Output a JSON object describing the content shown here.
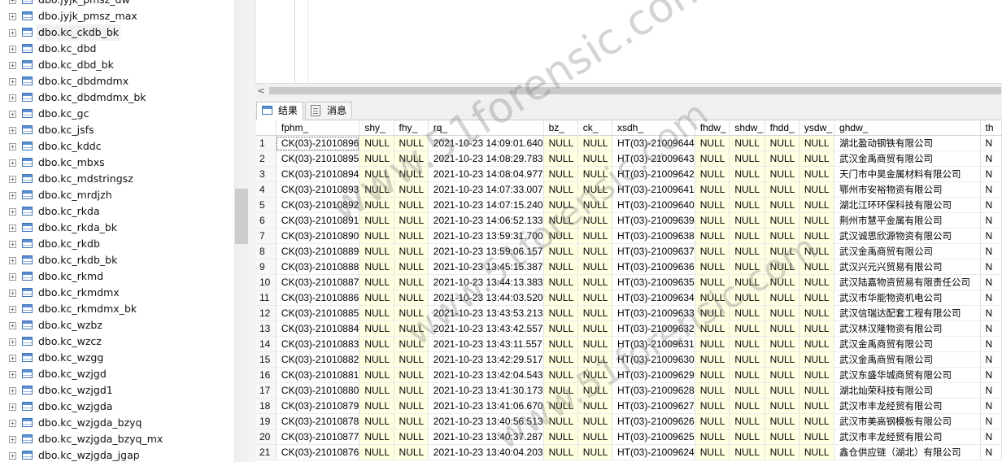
{
  "tree": {
    "items": [
      {
        "label": "dbo.jyjk_pmsz_dw",
        "expander": "+"
      },
      {
        "label": "dbo.jyjk_pmsz_max",
        "expander": "+"
      },
      {
        "label": "dbo.kc_ckdb_bk",
        "expander": "+",
        "selected": true
      },
      {
        "label": "dbo.kc_dbd",
        "expander": "+"
      },
      {
        "label": "dbo.kc_dbd_bk",
        "expander": "+"
      },
      {
        "label": "dbo.kc_dbdmdmx",
        "expander": "+"
      },
      {
        "label": "dbo.kc_dbdmdmx_bk",
        "expander": "+"
      },
      {
        "label": "dbo.kc_gc",
        "expander": "+"
      },
      {
        "label": "dbo.kc_jsfs",
        "expander": "+"
      },
      {
        "label": "dbo.kc_kddc",
        "expander": "+"
      },
      {
        "label": "dbo.kc_mbxs",
        "expander": "+"
      },
      {
        "label": "dbo.kc_mdstringsz",
        "expander": "+"
      },
      {
        "label": "dbo.kc_mrdjzh",
        "expander": "+"
      },
      {
        "label": "dbo.kc_rkda",
        "expander": "+"
      },
      {
        "label": "dbo.kc_rkda_bk",
        "expander": "+"
      },
      {
        "label": "dbo.kc_rkdb",
        "expander": "+"
      },
      {
        "label": "dbo.kc_rkdb_bk",
        "expander": "+"
      },
      {
        "label": "dbo.kc_rkmd",
        "expander": "+"
      },
      {
        "label": "dbo.kc_rkmdmx",
        "expander": "+"
      },
      {
        "label": "dbo.kc_rkmdmx_bk",
        "expander": "+"
      },
      {
        "label": "dbo.kc_wzbz",
        "expander": "+"
      },
      {
        "label": "dbo.kc_wzcz",
        "expander": "+"
      },
      {
        "label": "dbo.kc_wzgg",
        "expander": "+"
      },
      {
        "label": "dbo.kc_wzjgd",
        "expander": "+"
      },
      {
        "label": "dbo.kc_wzjgd1",
        "expander": "+"
      },
      {
        "label": "dbo.kc_wzjgda",
        "expander": "+"
      },
      {
        "label": "dbo.kc_wzjgda_bzyq",
        "expander": "+"
      },
      {
        "label": "dbo.kc_wzjgda_bzyq_mx",
        "expander": "+"
      },
      {
        "label": "dbo.kc_wzjgda_jgap",
        "expander": "+"
      }
    ]
  },
  "editor": {
    "scroll_left_arrow": "<"
  },
  "tabs": [
    {
      "label": "结果",
      "active": true
    },
    {
      "label": "消息",
      "active": false
    }
  ],
  "grid": {
    "columns": [
      "",
      "fphm_",
      "shy_",
      "fhy_",
      "rq_",
      "bz_",
      "ck_",
      "xsdh_",
      "fhdw_",
      "shdw_",
      "fhdd_",
      "ysdw_",
      "ghdw_",
      "th"
    ],
    "rows": [
      [
        "1",
        "CK(03)-21010896",
        "NULL",
        "NULL",
        "2021-10-23 14:09:01.640",
        "NULL",
        "NULL",
        "HT(03)-21009644",
        "NULL",
        "NULL",
        "NULL",
        "NULL",
        "湖北盈动钢铁有限公司",
        "N"
      ],
      [
        "2",
        "CK(03)-21010895",
        "NULL",
        "NULL",
        "2021-10-23 14:08:29.783",
        "NULL",
        "NULL",
        "HT(03)-21009643",
        "NULL",
        "NULL",
        "NULL",
        "NULL",
        "武汉金禹商贸有限公司",
        "N"
      ],
      [
        "3",
        "CK(03)-21010894",
        "NULL",
        "NULL",
        "2021-10-23 14:08:04.977",
        "NULL",
        "NULL",
        "HT(03)-21009642",
        "NULL",
        "NULL",
        "NULL",
        "NULL",
        "天门市中昊金属材料有限公司",
        "N"
      ],
      [
        "4",
        "CK(03)-21010893",
        "NULL",
        "NULL",
        "2021-10-23 14:07:33.007",
        "NULL",
        "NULL",
        "HT(03)-21009641",
        "NULL",
        "NULL",
        "NULL",
        "NULL",
        "鄂州市安裕物资有限公司",
        "N"
      ],
      [
        "5",
        "CK(03)-21010892",
        "NULL",
        "NULL",
        "2021-10-23 14:07:15.240",
        "NULL",
        "NULL",
        "HT(03)-21009640",
        "NULL",
        "NULL",
        "NULL",
        "NULL",
        "湖北江环环保科技有限公司",
        "N"
      ],
      [
        "6",
        "CK(03)-21010891",
        "NULL",
        "NULL",
        "2021-10-23 14:06:52.133",
        "NULL",
        "NULL",
        "HT(03)-21009639",
        "NULL",
        "NULL",
        "NULL",
        "NULL",
        "荆州市慧平金属有限公司",
        "N"
      ],
      [
        "7",
        "CK(03)-21010890",
        "NULL",
        "NULL",
        "2021-10-23 13:59:31.700",
        "NULL",
        "NULL",
        "HT(03)-21009638",
        "NULL",
        "NULL",
        "NULL",
        "NULL",
        "武汉诚思欣源物资有限公司",
        "N"
      ],
      [
        "8",
        "CK(03)-21010889",
        "NULL",
        "NULL",
        "2021-10-23 13:59:06.157",
        "NULL",
        "NULL",
        "HT(03)-21009637",
        "NULL",
        "NULL",
        "NULL",
        "NULL",
        "武汉金禹商贸有限公司",
        "N"
      ],
      [
        "9",
        "CK(03)-21010888",
        "NULL",
        "NULL",
        "2021-10-23 13:45:15.387",
        "NULL",
        "NULL",
        "HT(03)-21009636",
        "NULL",
        "NULL",
        "NULL",
        "NULL",
        "武汉兴元兴贸易有限公司",
        "N"
      ],
      [
        "10",
        "CK(03)-21010887",
        "NULL",
        "NULL",
        "2021-10-23 13:44:13.383",
        "NULL",
        "NULL",
        "HT(03)-21009635",
        "NULL",
        "NULL",
        "NULL",
        "NULL",
        "武汉陆嘉物资贸易有限责任公司",
        "N"
      ],
      [
        "11",
        "CK(03)-21010886",
        "NULL",
        "NULL",
        "2021-10-23 13:44:03.520",
        "NULL",
        "NULL",
        "HT(03)-21009634",
        "NULL",
        "NULL",
        "NULL",
        "NULL",
        "武汉市华能物资机电公司",
        "N"
      ],
      [
        "12",
        "CK(03)-21010885",
        "NULL",
        "NULL",
        "2021-10-23 13:43:53.213",
        "NULL",
        "NULL",
        "HT(03)-21009633",
        "NULL",
        "NULL",
        "NULL",
        "NULL",
        "武汉信瑞达配套工程有限公司",
        "N"
      ],
      [
        "13",
        "CK(03)-21010884",
        "NULL",
        "NULL",
        "2021-10-23 13:43:42.557",
        "NULL",
        "NULL",
        "HT(03)-21009632",
        "NULL",
        "NULL",
        "NULL",
        "NULL",
        "武汉林汉隆物资有限公司",
        "N"
      ],
      [
        "14",
        "CK(03)-21010883",
        "NULL",
        "NULL",
        "2021-10-23 13:43:11.557",
        "NULL",
        "NULL",
        "HT(03)-21009631",
        "NULL",
        "NULL",
        "NULL",
        "NULL",
        "武汉金禹商贸有限公司",
        "N"
      ],
      [
        "15",
        "CK(03)-21010882",
        "NULL",
        "NULL",
        "2021-10-23 13:42:29.517",
        "NULL",
        "NULL",
        "HT(03)-21009630",
        "NULL",
        "NULL",
        "NULL",
        "NULL",
        "武汉金禹商贸有限公司",
        "N"
      ],
      [
        "16",
        "CK(03)-21010881",
        "NULL",
        "NULL",
        "2021-10-23 13:42:04.543",
        "NULL",
        "NULL",
        "HT(03)-21009629",
        "NULL",
        "NULL",
        "NULL",
        "NULL",
        "武汉东盛华城商贸有限公司",
        "N"
      ],
      [
        "17",
        "CK(03)-21010880",
        "NULL",
        "NULL",
        "2021-10-23 13:41:30.173",
        "NULL",
        "NULL",
        "HT(03)-21009628",
        "NULL",
        "NULL",
        "NULL",
        "NULL",
        "湖北灿荣科技有限公司",
        "N"
      ],
      [
        "18",
        "CK(03)-21010879",
        "NULL",
        "NULL",
        "2021-10-23 13:41:06.670",
        "NULL",
        "NULL",
        "HT(03)-21009627",
        "NULL",
        "NULL",
        "NULL",
        "NULL",
        "武汉市丰龙经贸有限公司",
        "N"
      ],
      [
        "19",
        "CK(03)-21010878",
        "NULL",
        "NULL",
        "2021-10-23 13:40:56.513",
        "NULL",
        "NULL",
        "HT(03)-21009626",
        "NULL",
        "NULL",
        "NULL",
        "NULL",
        "武汉市美高钢模板有限公司",
        "N"
      ],
      [
        "20",
        "CK(03)-21010877",
        "NULL",
        "NULL",
        "2021-10-23 13:40:37.287",
        "NULL",
        "NULL",
        "HT(03)-21009625",
        "NULL",
        "NULL",
        "NULL",
        "NULL",
        "武汉市丰龙经贸有限公司",
        "N"
      ],
      [
        "21",
        "CK(03)-21010876",
        "NULL",
        "NULL",
        "2021-10-23 13:40:04.203",
        "NULL",
        "NULL",
        "HT(03)-21009624",
        "NULL",
        "NULL",
        "NULL",
        "NULL",
        "鑫仓供应链（湖北）有限公司",
        "N"
      ]
    ]
  },
  "watermark": {
    "text": "www.51forensic.com"
  }
}
